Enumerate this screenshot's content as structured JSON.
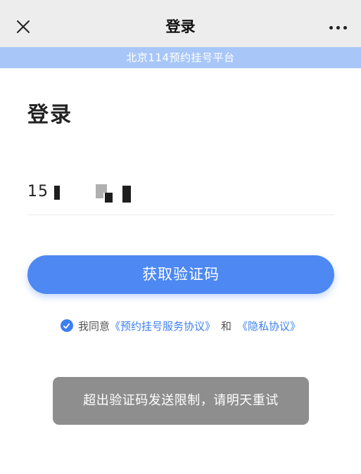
{
  "titlebar": {
    "title": "登录",
    "close_icon": "close-icon",
    "more_icon": "more-horizontal-icon"
  },
  "banner": {
    "text": "北京114预约挂号平台"
  },
  "form": {
    "heading": "登录",
    "phone_prefix": "15",
    "get_code_label": "获取验证码"
  },
  "agreement": {
    "checked": true,
    "prefix": "我同意",
    "terms_link": "《预约挂号服务协议》",
    "and_text": "和",
    "privacy_link": "《隐私协议》"
  },
  "toast": {
    "message": "超出验证码发送限制，请明天重试"
  },
  "colors": {
    "primary": "#4d88f3",
    "banner": "#a8c7f8",
    "link": "#3d7ff0",
    "toast_bg": "#8e8e8e",
    "titlebar_bg": "#ededed"
  }
}
